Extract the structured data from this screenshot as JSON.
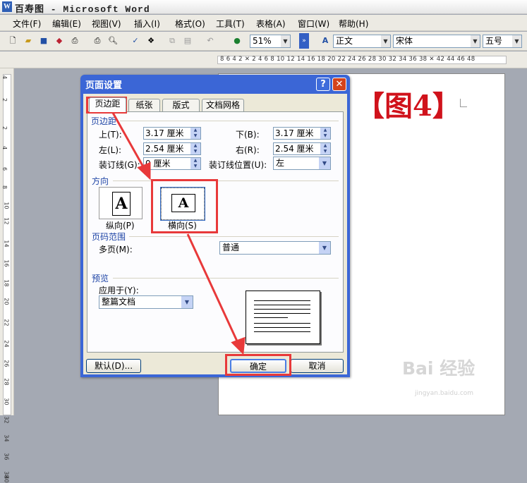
{
  "window": {
    "title": "百寿图 - Microsoft Word"
  },
  "menu": [
    "文件(F)",
    "编辑(E)",
    "视图(V)",
    "插入(I)",
    "格式(O)",
    "工具(T)",
    "表格(A)",
    "窗口(W)",
    "帮助(H)"
  ],
  "toolbar": {
    "zoom": "51%",
    "style": "正文",
    "font": "宋体",
    "size": "五号"
  },
  "ruler": {
    "horizontal": "8  6  4  2  ✕  2  4  6  8 10 12 14 16 18 20 22 24 26 28 30 32 34 36 38 ✕ 42 44 46 48",
    "vertical": [
      "4",
      "2",
      "2",
      "4",
      "6",
      "8",
      "10",
      "12",
      "14",
      "16",
      "18",
      "20",
      "22",
      "24",
      "26",
      "28",
      "30",
      "32",
      "34",
      "36",
      "38",
      "40"
    ]
  },
  "document": {
    "annotation": "【图4】"
  },
  "dialog": {
    "title": "页面设置",
    "tabs": [
      "页边距",
      "纸张",
      "版式",
      "文档网格"
    ],
    "margins": {
      "section": "页边距",
      "top_label": "上(T):",
      "top_value": "3.17 厘米",
      "bottom_label": "下(B):",
      "bottom_value": "3.17 厘米",
      "left_label": "左(L):",
      "left_value": "2.54 厘米",
      "right_label": "右(R):",
      "right_value": "2.54 厘米",
      "gutter_label": "装订线(G):",
      "gutter_value": "0 厘米",
      "gutter_pos_label": "装订线位置(U):",
      "gutter_pos_value": "左"
    },
    "orientation": {
      "section": "方向",
      "portrait": "纵向(P)",
      "landscape": "横向(S)"
    },
    "pages": {
      "section": "页码范围",
      "multiple_label": "多页(M):",
      "multiple_value": "普通"
    },
    "preview": {
      "section": "预览",
      "apply_label": "应用于(Y):",
      "apply_value": "整篇文档"
    },
    "buttons": {
      "default": "默认(D)...",
      "ok": "确定",
      "cancel": "取消"
    }
  },
  "watermark": {
    "text": "Bai 经验",
    "url": "jingyan.baidu.com"
  },
  "colors": {
    "highlight": "#e8393a",
    "title_bar": "#3b66d6",
    "annotation": "#d0121b"
  }
}
